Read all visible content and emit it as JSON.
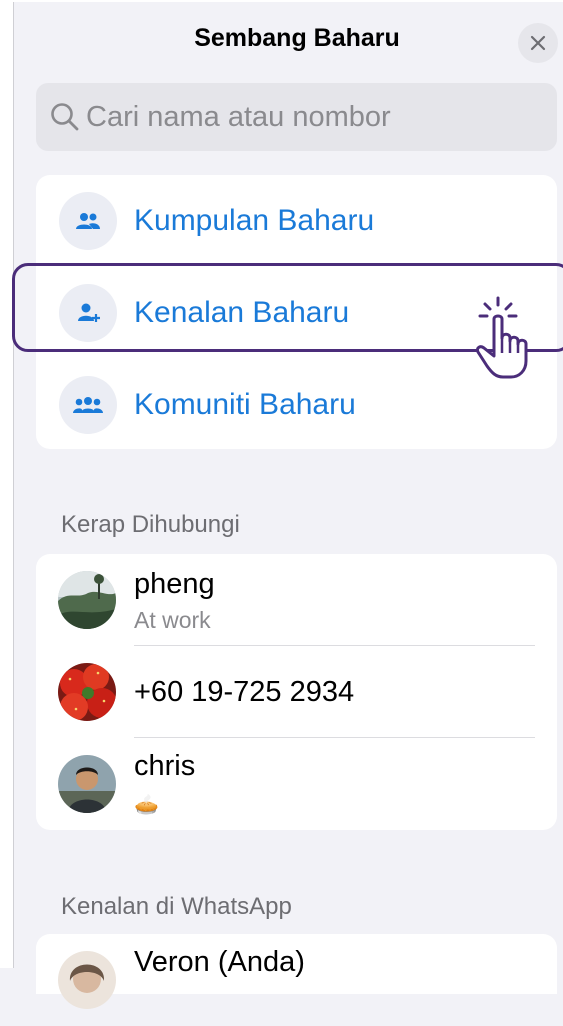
{
  "header": {
    "title": "Sembang Baharu"
  },
  "search": {
    "placeholder": "Cari nama atau nombor"
  },
  "actions": [
    {
      "label": "Kumpulan Baharu",
      "icon": "group-icon"
    },
    {
      "label": "Kenalan Baharu",
      "icon": "add-contact-icon"
    },
    {
      "label": "Komuniti Baharu",
      "icon": "community-icon"
    }
  ],
  "frequent": {
    "title": "Kerap Dihubungi",
    "contacts": [
      {
        "name": "pheng",
        "status": "At work",
        "avatar": "landscape-photo"
      },
      {
        "name": "+60 19-725 2934",
        "status": "",
        "avatar": "strawberry-photo"
      },
      {
        "name": "chris",
        "status": "🥧",
        "avatar": "person-photo"
      }
    ]
  },
  "whatsapp_contacts": {
    "title": "Kenalan di WhatsApp",
    "contacts": [
      {
        "name": "Veron (Anda)"
      }
    ]
  },
  "colors": {
    "accent": "#1a7ad8",
    "highlight": "#4b2d7a",
    "background": "#f2f2f7"
  }
}
